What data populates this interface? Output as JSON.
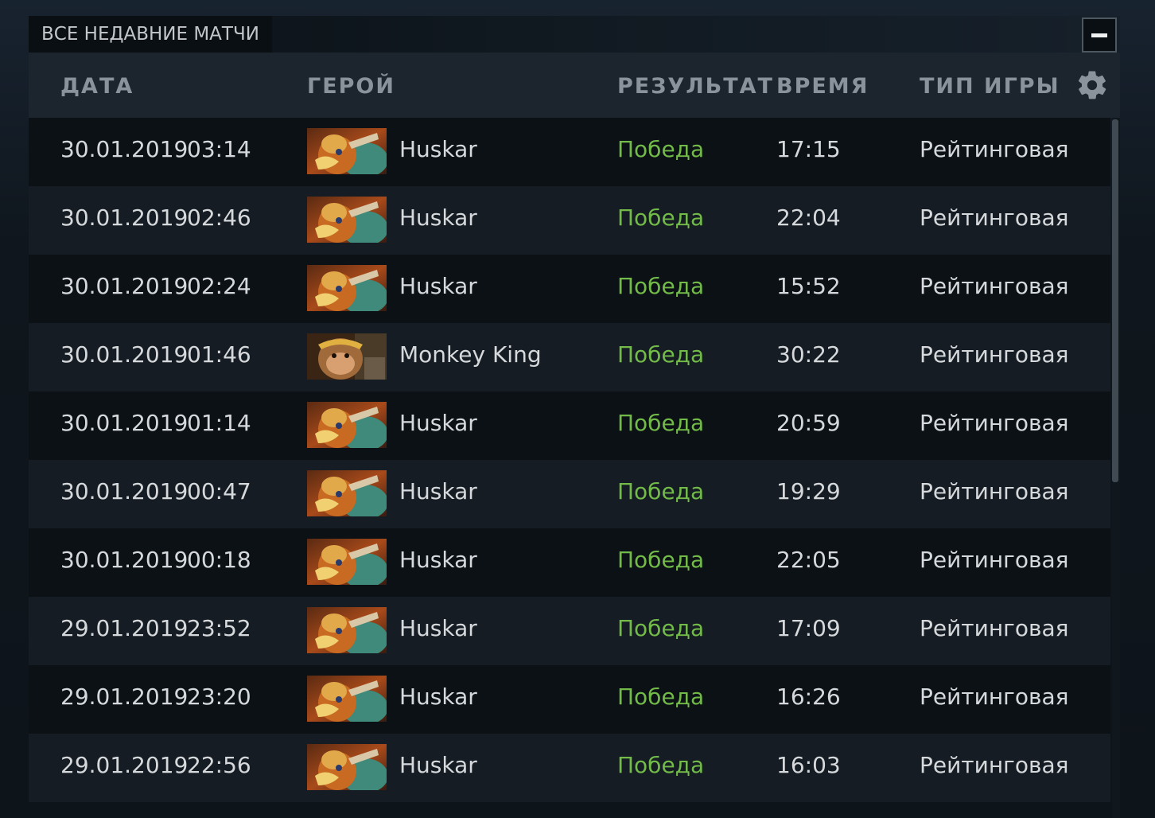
{
  "panel": {
    "title": "Все недавние матчи",
    "minimize_icon": "minus-icon"
  },
  "columns": {
    "date": "Дата",
    "hero": "Герой",
    "result": "Результат",
    "duration": "Время",
    "game_type": "Тип игры",
    "settings_icon": "gear-icon"
  },
  "colors": {
    "win": "#72bb48",
    "header_text": "#8a939c",
    "row_text": "#d6d9dc"
  },
  "matches": [
    {
      "date": "30.01.2019",
      "time": "03:14",
      "hero": "Huskar",
      "hero_icon": "huskar-portrait",
      "result": "Победа",
      "duration": "17:15",
      "type": "Рейтинговая"
    },
    {
      "date": "30.01.2019",
      "time": "02:46",
      "hero": "Huskar",
      "hero_icon": "huskar-portrait",
      "result": "Победа",
      "duration": "22:04",
      "type": "Рейтинговая"
    },
    {
      "date": "30.01.2019",
      "time": "02:24",
      "hero": "Huskar",
      "hero_icon": "huskar-portrait",
      "result": "Победа",
      "duration": "15:52",
      "type": "Рейтинговая"
    },
    {
      "date": "30.01.2019",
      "time": "01:46",
      "hero": "Monkey King",
      "hero_icon": "monkey-king-portrait",
      "result": "Победа",
      "duration": "30:22",
      "type": "Рейтинговая"
    },
    {
      "date": "30.01.2019",
      "time": "01:14",
      "hero": "Huskar",
      "hero_icon": "huskar-portrait",
      "result": "Победа",
      "duration": "20:59",
      "type": "Рейтинговая"
    },
    {
      "date": "30.01.2019",
      "time": "00:47",
      "hero": "Huskar",
      "hero_icon": "huskar-portrait",
      "result": "Победа",
      "duration": "19:29",
      "type": "Рейтинговая"
    },
    {
      "date": "30.01.2019",
      "time": "00:18",
      "hero": "Huskar",
      "hero_icon": "huskar-portrait",
      "result": "Победа",
      "duration": "22:05",
      "type": "Рейтинговая"
    },
    {
      "date": "29.01.2019",
      "time": "23:52",
      "hero": "Huskar",
      "hero_icon": "huskar-portrait",
      "result": "Победа",
      "duration": "17:09",
      "type": "Рейтинговая"
    },
    {
      "date": "29.01.2019",
      "time": "23:20",
      "hero": "Huskar",
      "hero_icon": "huskar-portrait",
      "result": "Победа",
      "duration": "16:26",
      "type": "Рейтинговая"
    },
    {
      "date": "29.01.2019",
      "time": "22:56",
      "hero": "Huskar",
      "hero_icon": "huskar-portrait",
      "result": "Победа",
      "duration": "16:03",
      "type": "Рейтинговая"
    }
  ]
}
